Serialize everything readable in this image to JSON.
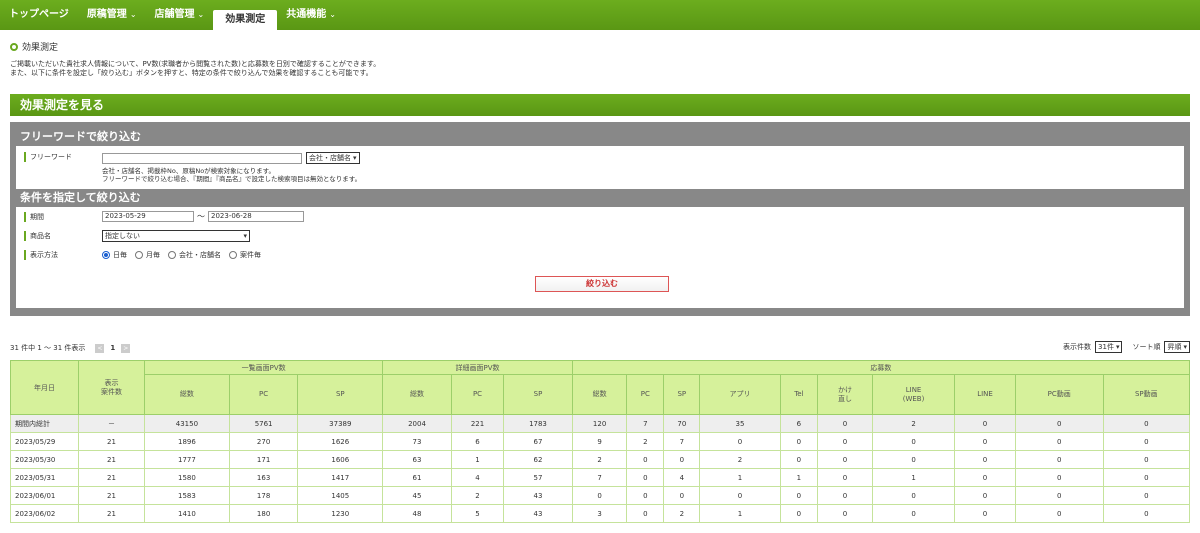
{
  "nav": {
    "items": [
      {
        "label": "トップページ",
        "chev": ""
      },
      {
        "label": "原稿管理",
        "chev": "⌄"
      },
      {
        "label": "店舗管理",
        "chev": "⌄"
      },
      {
        "label": "効果測定",
        "chev": ""
      },
      {
        "label": "共通機能",
        "chev": "⌄"
      }
    ],
    "active": "効果測定"
  },
  "section": {
    "title": "効果測定",
    "desc1": "ご掲載いただいた貴社求人情報について、PV数(求職者から閲覧された数)と応募数を日別で確認することができます。",
    "desc2": "また、以下に条件を設定し「絞り込む」ボタンを押すと、特定の条件で絞り込んで効果を確認することも可能です。"
  },
  "bar_title": "効果測定を見る",
  "freeword": {
    "heading": "フリーワードで絞り込む",
    "label": "フリーワード",
    "value": "",
    "select": "会社・店舗名",
    "note1": "会社・店舗名、掲載枠No、原稿Noが検索対象になります。",
    "note2": "フリーワードで絞り込む場合、『期間』『商品名』で設定した検索項目は無効となります。"
  },
  "conditions": {
    "heading": "条件を指定して絞り込む",
    "period_label": "期間",
    "date_from": "2023-05-29",
    "tilde": "～",
    "date_to": "2023-06-28",
    "product_label": "商品名",
    "product_select": "指定しない",
    "display_label": "表示方法",
    "options": [
      "日毎",
      "月毎",
      "会社・店舗名",
      "案件毎"
    ],
    "selected": "日毎",
    "submit": "絞り込む"
  },
  "pager": {
    "summary": "31 件中 1 ～ 31 件表示",
    "prev": "<",
    "page": "1",
    "next": ">"
  },
  "controls": {
    "count_label": "表示件数",
    "count_value": "31件",
    "sort_label": "ソート順",
    "sort_value": "昇順"
  },
  "table": {
    "col_date": "年月日",
    "col_count": "表示\n案件数",
    "group_list": "一覧画面PV数",
    "group_detail": "詳細画面PV数",
    "group_apply": "応募数",
    "sub_list": [
      "総数",
      "PC",
      "SP"
    ],
    "sub_detail": [
      "総数",
      "PC",
      "SP"
    ],
    "sub_apply": [
      "総数",
      "PC",
      "SP",
      "アプリ",
      "Tel",
      "かけ\n直し",
      "LINE\n(WEB)",
      "LINE",
      "PC動画",
      "SP動画"
    ],
    "rows": [
      [
        "期間内総計",
        "－",
        "43150",
        "5761",
        "37389",
        "2004",
        "221",
        "1783",
        "120",
        "7",
        "70",
        "35",
        "6",
        "0",
        "2",
        "0",
        "0",
        "0"
      ],
      [
        "2023/05/29",
        "21",
        "1896",
        "270",
        "1626",
        "73",
        "6",
        "67",
        "9",
        "2",
        "7",
        "0",
        "0",
        "0",
        "0",
        "0",
        "0",
        "0"
      ],
      [
        "2023/05/30",
        "21",
        "1777",
        "171",
        "1606",
        "63",
        "1",
        "62",
        "2",
        "0",
        "0",
        "2",
        "0",
        "0",
        "0",
        "0",
        "0",
        "0"
      ],
      [
        "2023/05/31",
        "21",
        "1580",
        "163",
        "1417",
        "61",
        "4",
        "57",
        "7",
        "0",
        "4",
        "1",
        "1",
        "0",
        "1",
        "0",
        "0",
        "0"
      ],
      [
        "2023/06/01",
        "21",
        "1583",
        "178",
        "1405",
        "45",
        "2",
        "43",
        "0",
        "0",
        "0",
        "0",
        "0",
        "0",
        "0",
        "0",
        "0",
        "0"
      ],
      [
        "2023/06/02",
        "21",
        "1410",
        "180",
        "1230",
        "48",
        "5",
        "43",
        "3",
        "0",
        "2",
        "1",
        "0",
        "0",
        "0",
        "0",
        "0",
        "0"
      ]
    ]
  },
  "colors": {
    "green": "#6aa820",
    "header_bg": "#d6f19b",
    "panel_bg": "#888888"
  }
}
